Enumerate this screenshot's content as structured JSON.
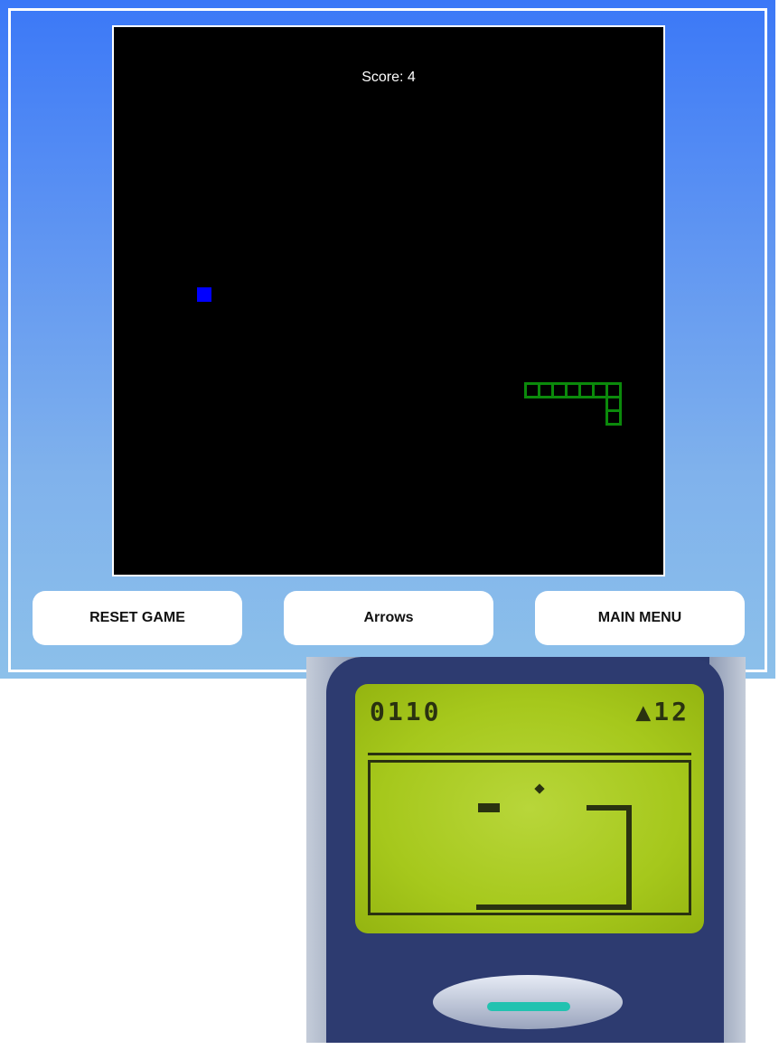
{
  "game": {
    "score_label": "Score: 4"
  },
  "buttons": {
    "reset": "RESET GAME",
    "controls": "Arrows",
    "menu": "MAIN MENU"
  },
  "colors": {
    "snake": "#0b8a0b",
    "food": "#0000ff",
    "board": "#000000"
  },
  "phone_screen": {
    "score": "0110",
    "bug_count": "12"
  }
}
